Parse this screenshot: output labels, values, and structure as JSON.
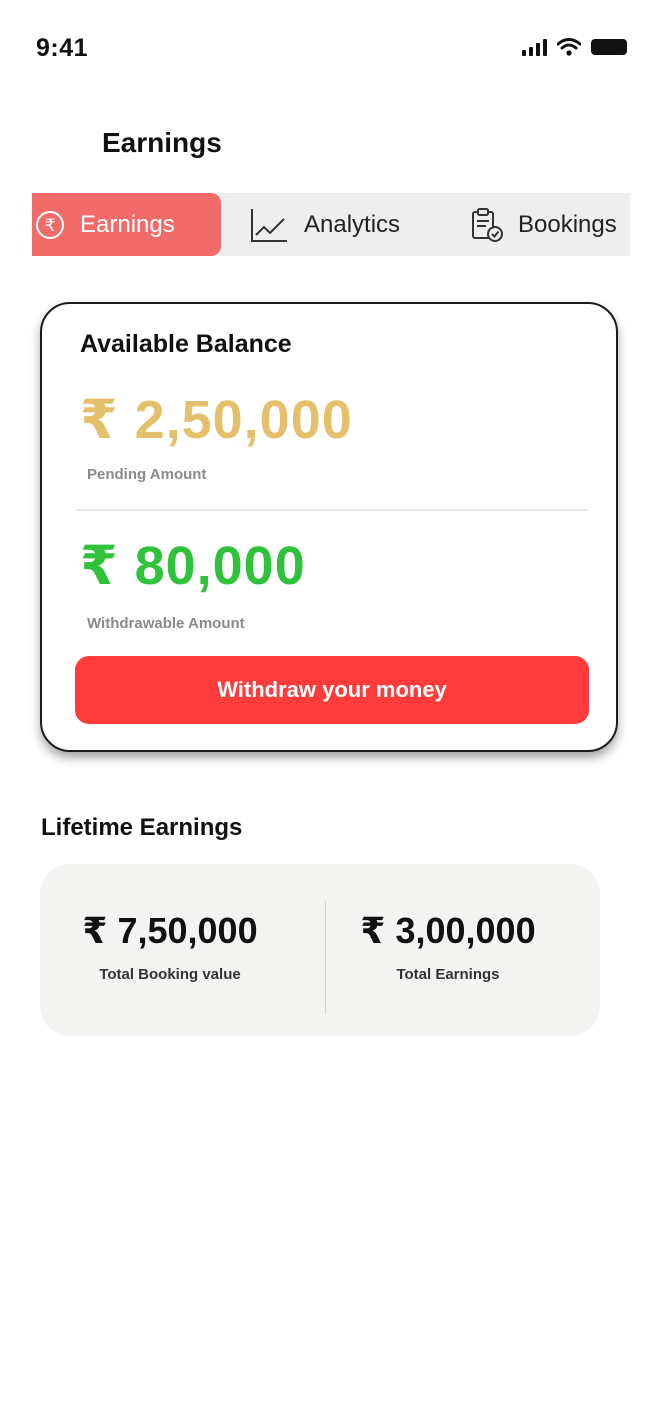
{
  "status_bar": {
    "time": "9:41"
  },
  "header": {
    "title": "Earnings"
  },
  "tabs": [
    {
      "label": "Earnings",
      "icon": "rupee-circle-icon",
      "active": true
    },
    {
      "label": "Analytics",
      "icon": "line-chart-icon",
      "active": false
    },
    {
      "label": "Bookings",
      "icon": "clipboard-check-icon",
      "active": false
    }
  ],
  "balance_card": {
    "title": "Available Balance",
    "pending_amount": "₹ 2,50,000",
    "pending_label": "Pending Amount",
    "withdrawable_amount": "₹ 80,000",
    "withdrawable_label": "Withdrawable Amount",
    "withdraw_button": "Withdraw your money"
  },
  "lifetime": {
    "title": "Lifetime Earnings",
    "stats": [
      {
        "value": "₹ 7,50,000",
        "label": "Total Booking value"
      },
      {
        "value": "₹ 3,00,000",
        "label": "Total Earnings"
      }
    ]
  },
  "colors": {
    "accent": "#ff3b3b",
    "active_tab": "#f26b6b",
    "pending": "#e5c06a",
    "withdrawable": "#2fc23a"
  }
}
